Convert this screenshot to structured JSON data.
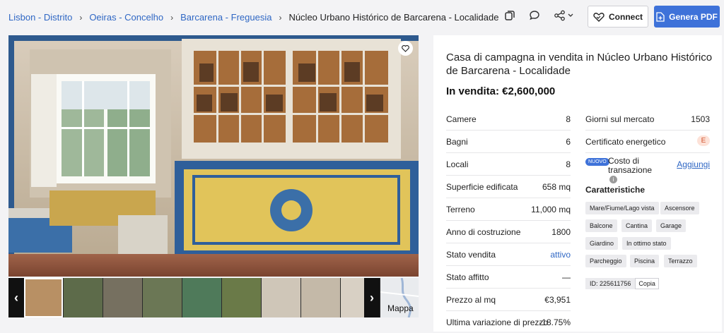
{
  "breadcrumbs": [
    {
      "label": "Lisbon - Distrito"
    },
    {
      "label": "Oeiras - Concelho"
    },
    {
      "label": "Barcarena - Freguesia"
    }
  ],
  "breadcrumb_current": "Núcleo Urbano Histórico de Barcarena - Localidade",
  "toolbar": {
    "connect_label": "Connect",
    "pdf_label": "Genera PDF"
  },
  "gallery": {
    "map_label": "Mappa"
  },
  "listing": {
    "title": "Casa di campagna in vendita in Núcleo Urbano Histórico de Barcarena - Localidade",
    "price": "In vendita: €2,600,000",
    "details_left": [
      {
        "key": "Camere",
        "value": "8"
      },
      {
        "key": "Bagni",
        "value": "6"
      },
      {
        "key": "Locali",
        "value": "8"
      },
      {
        "key": "Superficie edificata",
        "value": "658 mq"
      },
      {
        "key": "Terreno",
        "value": "11,000 mq"
      },
      {
        "key": "Anno di costruzione",
        "value": "1800"
      },
      {
        "key": "Stato vendita",
        "value": "attivo"
      },
      {
        "key": "Stato affitto",
        "value": "—"
      },
      {
        "key": "Prezzo al mq",
        "value": "€3,951"
      },
      {
        "key": "Ultima variazione di prezzo",
        "value": "-18.75%"
      }
    ],
    "days_on_market_label": "Giorni sul mercato",
    "days_on_market": "1503",
    "energy_label": "Certificato energetico",
    "energy_value": "E",
    "new_badge": "NUOVO",
    "transaction_cost_label": "Costo di transazione",
    "add_label": "Aggiungi",
    "features_title": "Caratteristiche",
    "features": [
      "Mare/Fiume/Lago vista",
      "Ascensore",
      "Balcone",
      "Cantina",
      "Garage",
      "Giardino",
      "In ottimo stato",
      "Parcheggio",
      "Piscina",
      "Terrazzo"
    ],
    "id_text": "ID: 225611756",
    "copy_label": "Copia"
  }
}
